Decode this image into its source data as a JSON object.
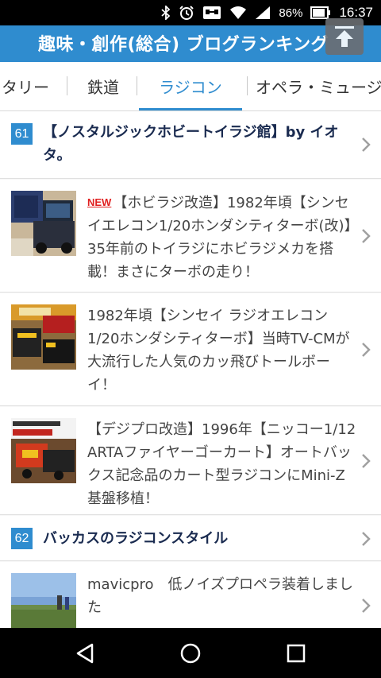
{
  "status_bar": {
    "battery_percent": "86%",
    "time": "16:37",
    "icons": [
      "bluetooth-icon",
      "alarm-icon",
      "cast-icon",
      "wifi-icon",
      "signal-icon",
      "battery-icon"
    ]
  },
  "header": {
    "title": "趣味・創作(総合)  ブログランキング"
  },
  "tabs": [
    {
      "label": "タリー"
    },
    {
      "label": "鉄道"
    },
    {
      "label": "ラジコン",
      "active": true
    },
    {
      "label": "オペラ・ミュージ"
    }
  ],
  "entries": [
    {
      "rank": "61",
      "blog_name": "【ノスタルジックホビートイラジ館】by イオタ。",
      "posts": [
        {
          "new_tag": "NEW",
          "text": "【ホビラジ改造】1982年頃【シンセイエレコン1/20ホンダシティターボ(改)】35年前のトイラジにホビラジメカを搭載！まさにターボの走り！"
        },
        {
          "text": "1982年頃【シンセイ ラジオエレコン1/20ホンダシティターボ】当時TV-CMが大流行した人気のカッ飛びトールボーイ！"
        },
        {
          "text": "【デジプロ改造】1996年【ニッコー1/12 ARTAファイヤーゴーカート】オートバックス記念品のカート型ラジコンにMini-Z基盤移植！"
        }
      ]
    },
    {
      "rank": "62",
      "blog_name": "バッカスのラジコンスタイル",
      "posts": [
        {
          "text": "mavicpro　低ノイズプロペラ装着しました"
        }
      ]
    }
  ],
  "colors": {
    "accent": "#2f8ccf",
    "blog_name": "#1a2b50",
    "new_tag": "#e02020"
  }
}
